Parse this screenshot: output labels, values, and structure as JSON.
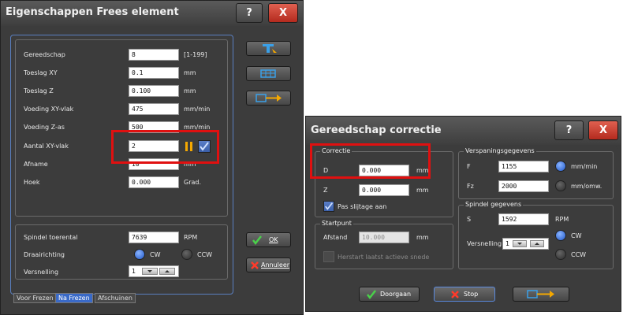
{
  "win1": {
    "title": "Eigenschappen Frees element",
    "help": "?",
    "close": "X",
    "fields": {
      "gereedschap": {
        "label": "Gereedschap",
        "value": "8",
        "unit": "[1-199]"
      },
      "toeslag_xy": {
        "label": "Toeslag XY",
        "value": "0.1",
        "unit": "mm"
      },
      "toeslag_z": {
        "label": "Toeslag Z",
        "value": "0.100",
        "unit": "mm"
      },
      "voeding_xy": {
        "label": "Voeding XY-vlak",
        "value": "475",
        "unit": "mm/min"
      },
      "voeding_z": {
        "label": "Voeding Z-as",
        "value": "500",
        "unit": "mm/min"
      },
      "aantal_xy": {
        "label": "Aantal XY-vlak",
        "value": "2"
      },
      "afname": {
        "label": "Afname",
        "value": "10",
        "unit": "mm"
      },
      "hoek": {
        "label": "Hoek",
        "value": "0.000",
        "unit": "Grad."
      }
    },
    "spindel": {
      "label": "Spindel toerental",
      "value": "7639",
      "unit": "RPM"
    },
    "draairichting": {
      "label": "Draairichting",
      "cw": "CW",
      "ccw": "CCW"
    },
    "versnelling": {
      "label": "Versnelling",
      "value": "1"
    },
    "tabs": [
      "Voor Frezen",
      "Na Frezen",
      "Afschuinen"
    ],
    "ok": "OK",
    "annuleer": "Annuleer",
    "accent": "#3a6ac8",
    "highlight": "#e01010"
  },
  "win2": {
    "title": "Gereedschap correctie",
    "help": "?",
    "close": "X",
    "correctie": {
      "title": "Correctie",
      "d_label": "D",
      "d_value": "0.000",
      "d_unit": "mm",
      "z_label": "Z",
      "z_value": "0.000",
      "z_unit": "mm",
      "pas": "Pas slijtage aan"
    },
    "startpunt": {
      "title": "Startpunt",
      "afstand_label": "Afstand",
      "afstand_value": "10.000",
      "afstand_unit": "mm",
      "herstart": "Herstart laatst actieve snede"
    },
    "verspaning": {
      "title": "Verspaningsgegevens",
      "f_label": "F",
      "f_value": "1155",
      "fz_label": "Fz",
      "fz_value": "2000",
      "unit1": "mm/min",
      "unit2": "mm/omw."
    },
    "spindel": {
      "title": "Spindel gegevens",
      "s_label": "S",
      "s_value": "1592",
      "s_unit": "RPM",
      "vers_label": "Versnelling",
      "vers_value": "1",
      "cw": "CW",
      "ccw": "CCW"
    },
    "doorgaan": "Doorgaan",
    "stop": "Stop"
  }
}
